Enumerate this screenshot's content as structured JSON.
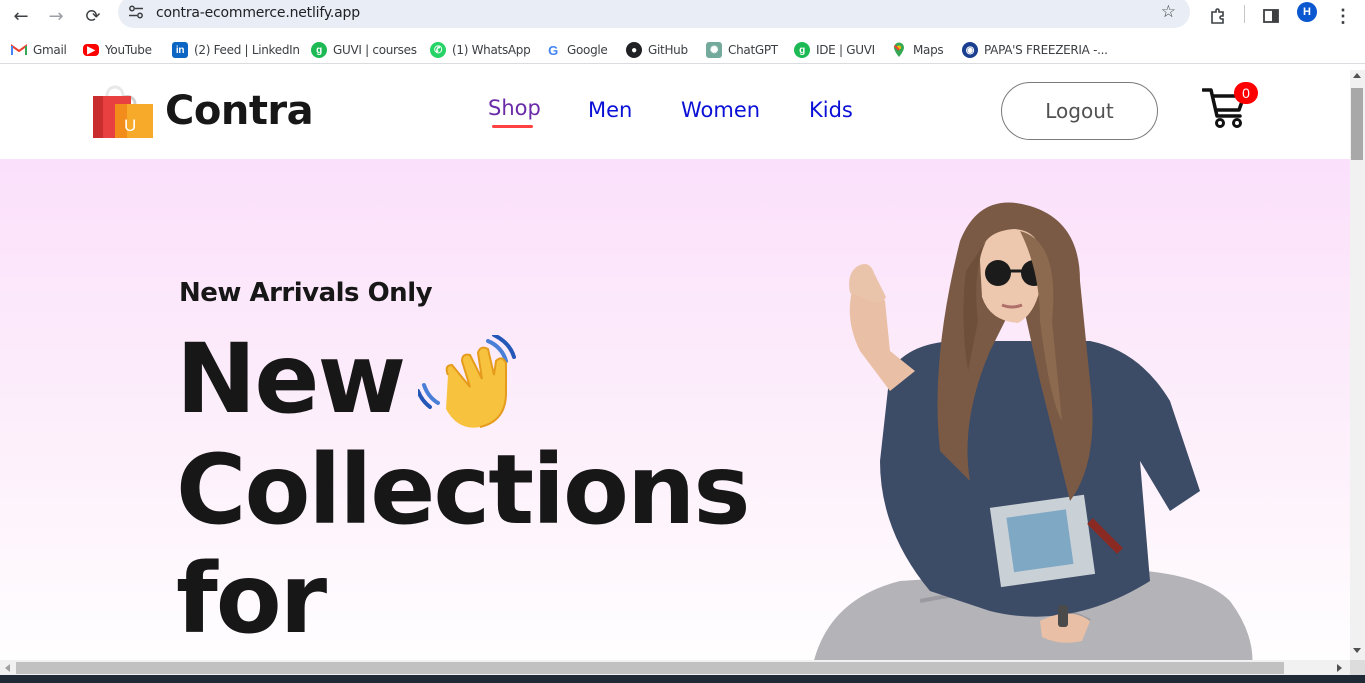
{
  "browser": {
    "url": "contra-ecommerce.netlify.app",
    "profile_initial": "H",
    "bookmarks": [
      {
        "label": "Gmail",
        "icon": "gmail-icon",
        "color": "#ea4335"
      },
      {
        "label": "YouTube",
        "icon": "youtube-icon",
        "color": "#ff0000"
      },
      {
        "label": "(2) Feed | LinkedIn",
        "icon": "linkedin-icon",
        "color": "#0a66c2"
      },
      {
        "label": "GUVI | courses",
        "icon": "guvi-icon",
        "color": "#1db954"
      },
      {
        "label": "(1) WhatsApp",
        "icon": "whatsapp-icon",
        "color": "#25d366"
      },
      {
        "label": "Google",
        "icon": "google-icon",
        "color": "#4285f4"
      },
      {
        "label": "GitHub",
        "icon": "github-icon",
        "color": "#202124"
      },
      {
        "label": "ChatGPT",
        "icon": "chatgpt-icon",
        "color": "#74aa9c"
      },
      {
        "label": "IDE | GUVI",
        "icon": "guvi-icon",
        "color": "#1db954"
      },
      {
        "label": "Maps",
        "icon": "maps-icon",
        "color": "#34a853"
      },
      {
        "label": "PAPA'S FREEZERIA -...",
        "icon": "papas-icon",
        "color": "#1a3f8f"
      }
    ]
  },
  "site": {
    "brand": "Contra",
    "menu": [
      {
        "label": "Shop",
        "active": true
      },
      {
        "label": "Men",
        "active": false
      },
      {
        "label": "Women",
        "active": false
      },
      {
        "label": "Kids",
        "active": false
      }
    ],
    "logout_label": "Logout",
    "cart_count": "0"
  },
  "hero": {
    "kicker": "New Arrivals Only",
    "line1": "New",
    "line2": "Collections",
    "line3": "for"
  },
  "colors": {
    "menu_link": "#0b10d6",
    "menu_active": "#6a2ba8",
    "active_underline": "#ff4141",
    "hero_top": "#fbe0fb",
    "badge": "#ff0000"
  }
}
